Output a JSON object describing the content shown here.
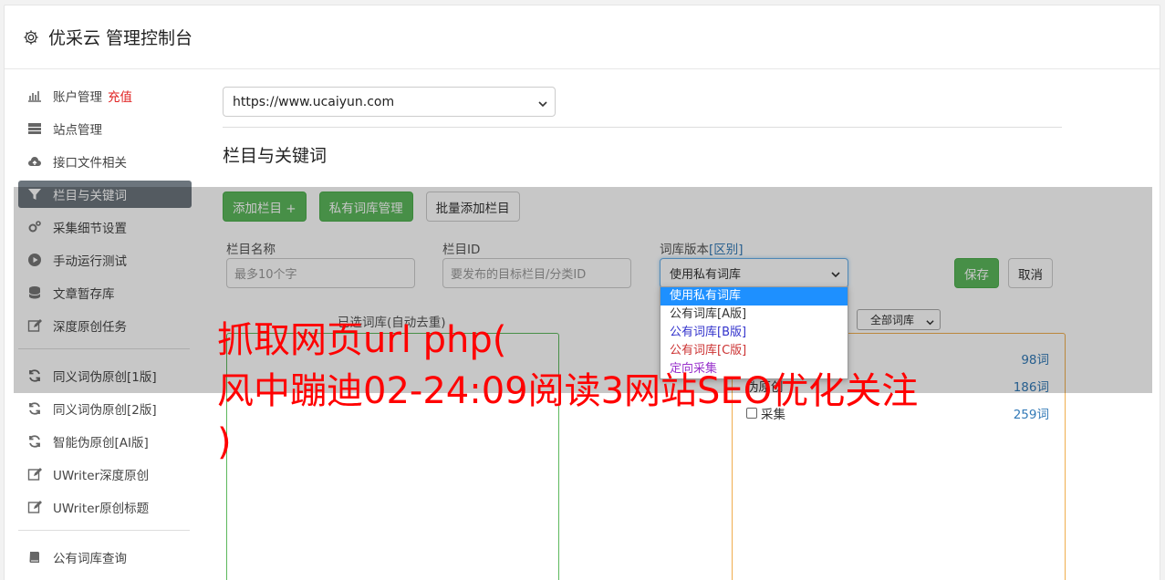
{
  "header": {
    "title": "优采云 管理控制台",
    "icon": "gear-icon"
  },
  "sidebar": {
    "items": [
      {
        "label": "账户管理",
        "badge": "充值",
        "icon": "bar-chart-icon"
      },
      {
        "label": "站点管理",
        "icon": "server-icon"
      },
      {
        "label": "接口文件相关",
        "icon": "cloud-upload-icon"
      },
      {
        "label": "栏目与关键词",
        "icon": "filter-icon",
        "active": true
      },
      {
        "label": "采集细节设置",
        "icon": "cogs-icon"
      },
      {
        "label": "手动运行测试",
        "icon": "play-circle-icon"
      },
      {
        "label": "文章暂存库",
        "icon": "database-icon"
      },
      {
        "label": "深度原创任务",
        "icon": "edit-icon"
      }
    ],
    "items2": [
      {
        "label": "同义词伪原创[1版]",
        "icon": "refresh-icon"
      },
      {
        "label": "同义词伪原创[2版]",
        "icon": "refresh-icon"
      },
      {
        "label": "智能伪原创[AI版]",
        "icon": "refresh-icon"
      },
      {
        "label": "UWriter深度原创",
        "icon": "edit-icon"
      },
      {
        "label": "UWriter原创标题",
        "icon": "edit-icon"
      }
    ],
    "items3": [
      {
        "label": "公有词库查询",
        "icon": "book-icon"
      }
    ]
  },
  "main": {
    "site_select_value": "https://www.ucaiyun.com",
    "section_title": "栏目与关键词",
    "buttons": {
      "add_column": "添加栏目 +",
      "private_lib": "私有词库管理",
      "batch_add": "批量添加栏目",
      "save": "保存",
      "cancel": "取消"
    },
    "form": {
      "name_label": "栏目名称",
      "name_placeholder": "最多10个字",
      "id_label": "栏目ID",
      "id_placeholder": "要发布的目标栏目/分类ID",
      "version_label": "词库版本",
      "version_link": "[区别]",
      "version_value": "使用私有词库"
    },
    "dropdown_options": [
      {
        "label": "使用私有词库",
        "color": "#ffffff",
        "selected": true
      },
      {
        "label": "公有词库[A版]",
        "color": "#333333"
      },
      {
        "label": "公有词库[B版]",
        "color": "#3333cc"
      },
      {
        "label": "公有词库[C版]",
        "color": "#cc3333"
      },
      {
        "label": "定向采集",
        "color": "#9933cc"
      }
    ],
    "selected_lib_label": "已选词库(自动去重)",
    "lib_filter_value": "全部词库",
    "lib_rows": [
      {
        "label": "",
        "count": "98词"
      },
      {
        "label": "伪原创",
        "count": "186词"
      },
      {
        "label": "采集",
        "count": "259词"
      }
    ]
  },
  "watermark": {
    "line1": "抓取网页url php(",
    "line2": "风中蹦迪02-24:09阅读3网站SEO优化关注",
    "line3": ")"
  }
}
